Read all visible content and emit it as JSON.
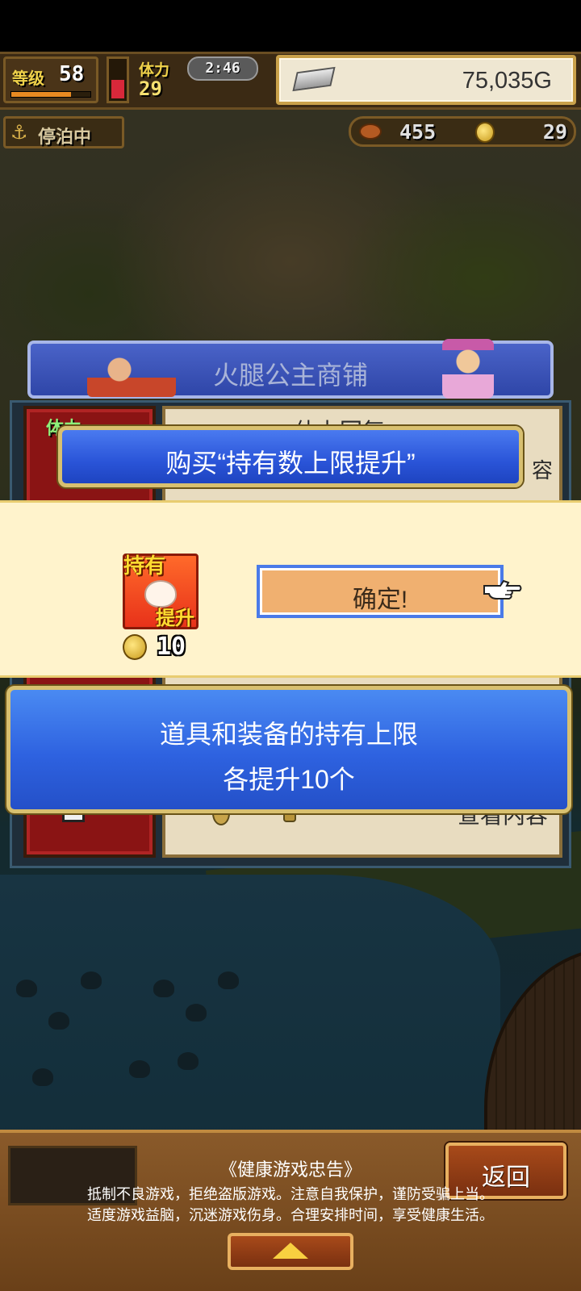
{
  "hud": {
    "level_label": "等级",
    "level_value": "58",
    "stamina_label": "体力",
    "stamina_value": "29",
    "timer": "2:46",
    "gold": "75,035G",
    "dock_status": "停泊中",
    "food_count": "455",
    "medal_count": "29",
    "xp_fraction": 0.75,
    "stamina_fraction": 0.55
  },
  "shop": {
    "title": "火腿公主商铺",
    "item_badge": "体力",
    "item_name": "体力回复",
    "item_trailing": "容",
    "view_label": "查看内容"
  },
  "dialog": {
    "title": "购买“持有数上限提升”",
    "item_icon_top": "持有",
    "item_icon_bottom": "提升",
    "cost": "10",
    "confirm_label": "确定!",
    "description_line1": "道具和装备的持有上限",
    "description_line2": "各提升10个"
  },
  "footer": {
    "back_label": "返回",
    "notice_title": "《健康游戏忠告》",
    "notice_line1": "抵制不良游戏，拒绝盗版游戏。注意自我保护，谨防受骗上当。",
    "notice_line2": "适度游戏益脑，沉迷游戏伤身。合理安排时间，享受健康生活。"
  },
  "colors": {
    "dialog_blue": "#2e62e0",
    "confirm_fill": "#f0b070",
    "band_cream": "#fff3cc",
    "frame_gold": "#d8c070"
  },
  "icons": [
    "gold-bar-icon",
    "anchor-icon",
    "meat-icon",
    "medal-coin-icon",
    "coin-icon",
    "pointing-hand-icon",
    "up-arrow-icon"
  ]
}
